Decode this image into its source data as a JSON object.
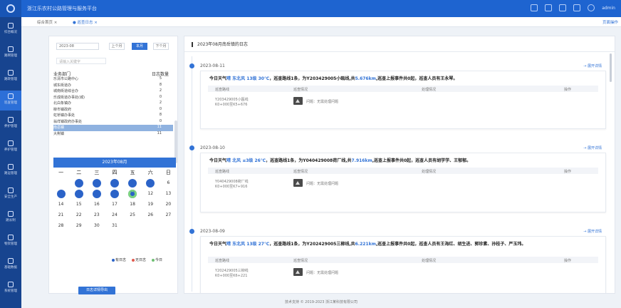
{
  "app": {
    "title": "浙江乐农村公路管理与服务平台",
    "user": "admin"
  },
  "breadcrumbs": [
    {
      "label": "综合首页 ×"
    },
    {
      "label": "● 巡查日志 ×"
    }
  ],
  "breadcrumb_right": "页面操作",
  "sidebar": {
    "items": [
      {
        "label": "综合概况",
        "icon": "home-icon"
      },
      {
        "label": "路网管理",
        "icon": "road-icon"
      },
      {
        "label": "路政管理",
        "icon": "shield-icon"
      },
      {
        "label": "巡查管理",
        "icon": "patrol-icon",
        "active": true
      },
      {
        "label": "养护管理",
        "icon": "maintain-icon"
      },
      {
        "label": "养护管理",
        "icon": "tools-icon"
      },
      {
        "label": "路运管理",
        "icon": "transport-icon"
      },
      {
        "label": "安全生产",
        "icon": "safety-icon"
      },
      {
        "label": "路长制",
        "icon": "person-icon"
      },
      {
        "label": "物资管理",
        "icon": "box-icon"
      },
      {
        "label": "基础数据",
        "icon": "database-icon"
      },
      {
        "label": "系统管理",
        "icon": "settings-icon"
      }
    ]
  },
  "filter": {
    "date": "2023-08",
    "prev_label": "上个月",
    "current_label": "本月",
    "next_label": "下个月",
    "search_placeholder": "请输入关键字"
  },
  "dept_table": {
    "col_dept": "业务部门",
    "col_count": "日志数量",
    "rows": [
      {
        "name": "乐清市公路中心",
        "count": "5"
      },
      {
        "name": "城东街道办",
        "count": "8"
      },
      {
        "name": "城南街道综合办",
        "count": "2"
      },
      {
        "name": "乐成街道办事处(城)",
        "count": "0"
      },
      {
        "name": "北白象镇办",
        "count": "2"
      },
      {
        "name": "柳市镇政府",
        "count": "0"
      },
      {
        "name": "虹桥镇办事处",
        "count": "8"
      },
      {
        "name": "翁垟镇政府办事处",
        "count": "0"
      },
      {
        "name": "南岳镇",
        "count": "11",
        "selected": true
      },
      {
        "name": "大荆镇",
        "count": "11"
      }
    ]
  },
  "calendar": {
    "header": "2023年08月",
    "weekdays": [
      "一",
      "二",
      "三",
      "四",
      "五",
      "六",
      "日"
    ],
    "days": [
      {
        "label": "",
        "state": "none"
      },
      {
        "label": "1",
        "state": "blue"
      },
      {
        "label": "2",
        "state": "blue"
      },
      {
        "label": "3",
        "state": "blue"
      },
      {
        "label": "4",
        "state": "blue"
      },
      {
        "label": "5",
        "state": "blue"
      },
      {
        "label": "6",
        "state": "none"
      },
      {
        "label": "7",
        "state": "blue"
      },
      {
        "label": "8",
        "state": "blue"
      },
      {
        "label": "9",
        "state": "blue"
      },
      {
        "label": "10",
        "state": "blue"
      },
      {
        "label": "11",
        "state": "bgreen"
      },
      {
        "label": "12",
        "state": "none"
      },
      {
        "label": "13",
        "state": "none"
      },
      {
        "label": "14",
        "state": "none"
      },
      {
        "label": "15",
        "state": "none"
      },
      {
        "label": "16",
        "state": "none"
      },
      {
        "label": "17",
        "state": "none"
      },
      {
        "label": "18",
        "state": "none"
      },
      {
        "label": "19",
        "state": "none"
      },
      {
        "label": "20",
        "state": "none"
      },
      {
        "label": "21",
        "state": "none"
      },
      {
        "label": "22",
        "state": "none"
      },
      {
        "label": "23",
        "state": "none"
      },
      {
        "label": "24",
        "state": "none"
      },
      {
        "label": "25",
        "state": "none"
      },
      {
        "label": "26",
        "state": "none"
      },
      {
        "label": "27",
        "state": "none"
      },
      {
        "label": "28",
        "state": "none"
      },
      {
        "label": "29",
        "state": "none"
      },
      {
        "label": "30",
        "state": "none"
      },
      {
        "label": "31",
        "state": "none"
      },
      {
        "label": "",
        "state": "none"
      },
      {
        "label": "",
        "state": "none"
      },
      {
        "label": "",
        "state": "none"
      }
    ],
    "legend": [
      {
        "label": "有日志",
        "color": "#2b63c8"
      },
      {
        "label": "无日志",
        "color": "#e05a4f"
      },
      {
        "label": "今日",
        "color": "#6fbf73"
      }
    ]
  },
  "detail_button": "日志详情导出",
  "calendar_title": "2023年08月南岳镇的日志",
  "entries": [
    {
      "date": "2023-08-11",
      "link": "→ 展开详情",
      "summary_parts": [
        {
          "t": "今日天气",
          "hl": false
        },
        {
          "t": "晴 东北风 13级 30℃",
          "hl": true
        },
        {
          "t": "，巡查路线1条，为Y203429005小瓯线,共",
          "hl": false
        },
        {
          "t": "5.676km",
          "hl": true
        },
        {
          "t": ",巡查上报事件共0起，巡查人员有王永琴。",
          "hl": false
        }
      ],
      "cols": [
        "巡查路线",
        "巡查情况",
        "处理情况",
        "操作"
      ],
      "route_name": "Y203429005小瓯线",
      "route_sub": "K0+000至K5+676",
      "status": "问题：无需处理问题"
    },
    {
      "date": "2023-08-10",
      "link": "→ 展开详情",
      "summary_parts": [
        {
          "t": "今日天气",
          "hl": false
        },
        {
          "t": "晴 北风 ≤3级 26℃",
          "hl": true
        },
        {
          "t": "，巡查路线1条，为Y040429008荷厂线,共",
          "hl": false
        },
        {
          "t": "7.916km",
          "hl": true
        },
        {
          "t": ",巡查上报事件共0起，巡查人员有胡学学、王郁郁。",
          "hl": false
        }
      ],
      "cols": [
        "巡查路线",
        "巡查情况",
        "处理情况",
        "操作"
      ],
      "route_name": "Y040429008荷厂线",
      "route_sub": "K0+000至K7+916",
      "status": "问题：无需处理问题"
    },
    {
      "date": "2023-08-09",
      "link": "→ 展开详情",
      "summary_parts": [
        {
          "t": "今日天气",
          "hl": false
        },
        {
          "t": "晴 东北风 13级 27℃",
          "hl": true
        },
        {
          "t": "，巡查路线1条，为Y202429005三柳线,共",
          "hl": false
        },
        {
          "t": "6.221km",
          "hl": true
        },
        {
          "t": ",巡查上报事件共0起，巡查人员有王海红、胡生进、郭珍素、孙桂子、严玉玮。",
          "hl": false
        }
      ],
      "cols": [
        "巡查路线",
        "巡查情况",
        "处理情况",
        "操作"
      ],
      "route_name": "Y202429005三柳线",
      "route_sub": "K0+000至K6+221",
      "status": "问题：无需处理问题"
    }
  ],
  "footer": "技术支持 © 2019-2023 浙江某科技有限公司"
}
